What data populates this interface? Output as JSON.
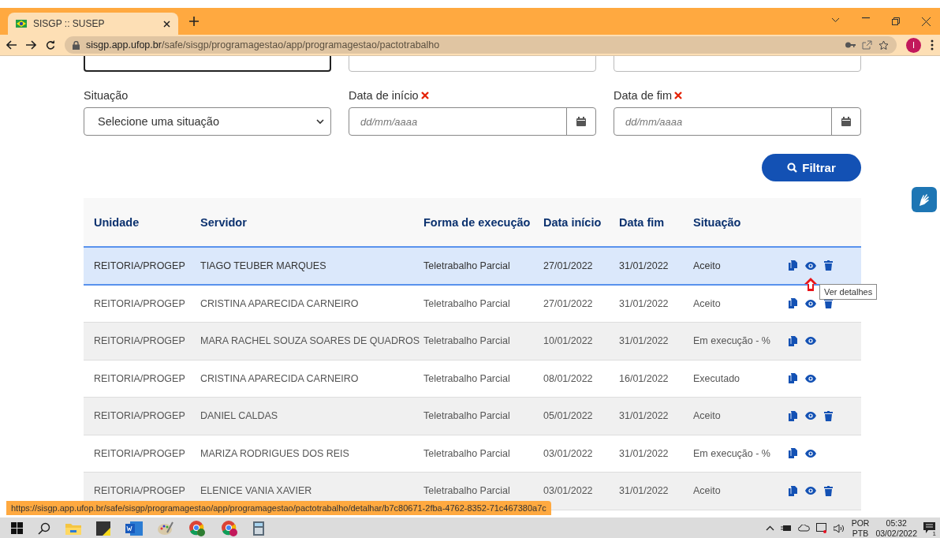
{
  "browser": {
    "tab_title": "SISGP :: SUSEP",
    "url_host": "sisgp.app.ufop.br",
    "url_path": "/safe/sisgp/programagestao/app/programagestao/pactotrabalho",
    "profile_initial": "I"
  },
  "filters": {
    "fields": [
      {
        "label": "Situação",
        "required": false,
        "kind": "select",
        "placeholder": "Selecione uma situação"
      },
      {
        "label": "Data de início",
        "required": true,
        "kind": "date",
        "placeholder": "dd/mm/aaaa"
      },
      {
        "label": "Data de fim",
        "required": true,
        "kind": "date",
        "placeholder": "dd/mm/aaaa"
      }
    ],
    "button": "Filtrar"
  },
  "table": {
    "columns": [
      "Unidade",
      "Servidor",
      "Forma de execução",
      "Data início",
      "Data fim",
      "Situação"
    ],
    "rows": [
      {
        "cells": [
          "REITORIA/PROGEP",
          "TIAGO TEUBER MARQUES",
          "Teletrabalho Parcial",
          "27/01/2022",
          "31/01/2022",
          "Aceito"
        ],
        "selected": true,
        "deletable": true
      },
      {
        "cells": [
          "REITORIA/PROGEP",
          "CRISTINA APARECIDA CARNEIRO",
          "Teletrabalho Parcial",
          "27/01/2022",
          "31/01/2022",
          "Aceito"
        ],
        "selected": false,
        "deletable": true
      },
      {
        "cells": [
          "REITORIA/PROGEP",
          "MARA RACHEL SOUZA SOARES DE QUADROS",
          "Teletrabalho Parcial",
          "10/01/2022",
          "31/01/2022",
          "Em execução - %"
        ],
        "selected": false,
        "deletable": false
      },
      {
        "cells": [
          "REITORIA/PROGEP",
          "CRISTINA APARECIDA CARNEIRO",
          "Teletrabalho Parcial",
          "08/01/2022",
          "16/01/2022",
          "Executado"
        ],
        "selected": false,
        "deletable": false
      },
      {
        "cells": [
          "REITORIA/PROGEP",
          "DANIEL CALDAS",
          "Teletrabalho Parcial",
          "05/01/2022",
          "31/01/2022",
          "Aceito"
        ],
        "selected": false,
        "deletable": true
      },
      {
        "cells": [
          "REITORIA/PROGEP",
          "MARIZA RODRIGUES DOS REIS",
          "Teletrabalho Parcial",
          "03/01/2022",
          "31/01/2022",
          "Em execução - %"
        ],
        "selected": false,
        "deletable": false
      },
      {
        "cells": [
          "REITORIA/PROGEP",
          "ELENICE VANIA XAVIER",
          "Teletrabalho Parcial",
          "03/01/2022",
          "31/01/2022",
          "Aceito"
        ],
        "selected": false,
        "deletable": true
      }
    ]
  },
  "tooltip": "Ver detalhes",
  "status_url": "https://sisgp.app.ufop.br/safe/sisgp/programagestao/app/programagestao/pactotrabalho/detalhar/b7c80671-2fba-4762-8352-71c467380a7c",
  "taskbar": {
    "language": "POR",
    "layout": "PTB",
    "time": "05:32",
    "date": "03/02/2022",
    "notifications": "1"
  }
}
